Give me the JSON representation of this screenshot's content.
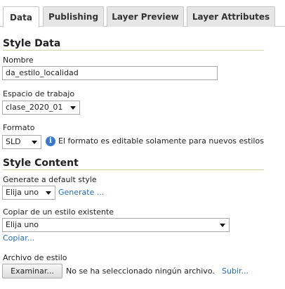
{
  "tabs": [
    {
      "label": "Data",
      "active": true
    },
    {
      "label": "Publishing",
      "active": false
    },
    {
      "label": "Layer Preview",
      "active": false
    },
    {
      "label": "Layer Attributes",
      "active": false
    }
  ],
  "style_data": {
    "title": "Style Data",
    "nombre_label": "Nombre",
    "nombre_value": "da_estilo_localidad",
    "workspace_label": "Espacio de trabajo",
    "workspace_value": "clase_2020_01",
    "format_label": "Formato",
    "format_value": "SLD",
    "format_note": "El formato es editable solamente para nuevos estilos"
  },
  "style_content": {
    "title": "Style Content",
    "generate_label": "Generate a default style",
    "generate_select_value": "Elija uno",
    "generate_link": "Generate ...",
    "copy_label": "Copiar de un estilo existente",
    "copy_select_value": "Elija uno",
    "copy_link": "Copiar...",
    "file_label": "Archivo de estilo",
    "browse_button": "Examinar...",
    "no_file_text": "No se ha seleccionado ningún archivo.",
    "upload_link": "Subir..."
  },
  "colors": {
    "link": "#2b6cb0",
    "section_rule": "#cfd6a6",
    "info_icon": "#3c78c8"
  }
}
